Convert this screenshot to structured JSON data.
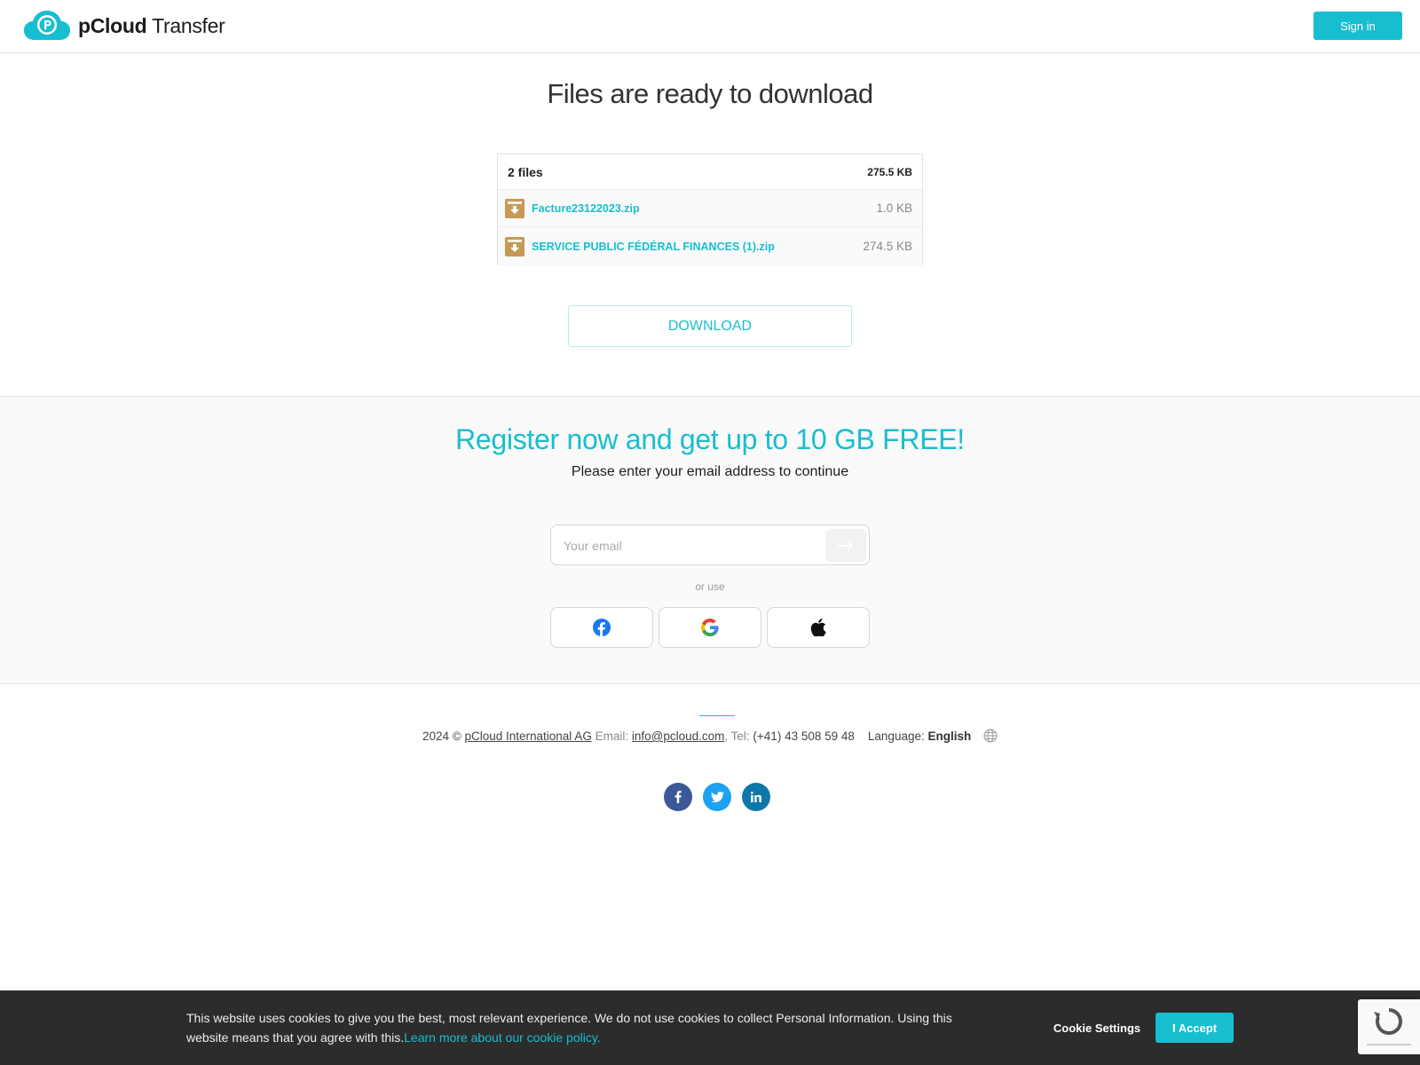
{
  "header": {
    "logo_brand": "pCloud",
    "logo_product": "Transfer",
    "signin_label": "Sign in"
  },
  "main": {
    "title": "Files are ready to download",
    "files_count": "2 files",
    "files_total": "275.5 KB",
    "files": [
      {
        "name": "Facture23122023.zip",
        "size": "1.0 KB",
        "icon": "zip-download-icon"
      },
      {
        "name": "SERVICE PUBLIC FÉDÉRAL FINANCES (1).zip",
        "size": "274.5 KB",
        "icon": "zip-download-icon"
      }
    ],
    "download_label": "DOWNLOAD"
  },
  "register": {
    "title": "Register now and get up to 10 GB FREE!",
    "subtitle": "Please enter your email address to continue",
    "email_placeholder": "Your email",
    "or_use": "or use",
    "social": [
      "facebook-icon",
      "google-icon",
      "apple-icon"
    ]
  },
  "footer": {
    "year": "2024 ©",
    "company": "pCloud International AG",
    "email_label": "Email:",
    "email": "info@pcloud.com",
    "tel_label": ", Tel:",
    "tel": "(+41) 43 508 59 48",
    "language_label": "Language:",
    "language": "English",
    "social": [
      "facebook-icon",
      "twitter-icon",
      "linkedin-icon"
    ]
  },
  "cookie": {
    "text": "This website uses cookies to give you the best, most relevant experience. We do not use cookies to collect Personal Information. Using this website means that you agree with this.",
    "link": "Learn more about our cookie policy.",
    "settings_label": "Cookie Settings",
    "accept_label": "I Accept"
  },
  "colors": {
    "accent": "#17bed0",
    "file_icon": "#c49a55",
    "cookie_bg": "#2c2c2c",
    "facebook": "#3b5998",
    "twitter": "#1da1f2",
    "linkedin": "#0e76a8"
  }
}
